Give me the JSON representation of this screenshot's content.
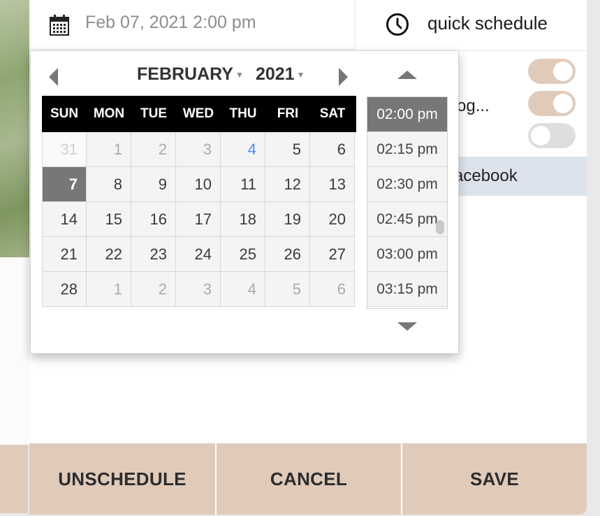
{
  "post": {
    "date_value": "Feb 07, 2021 2:00 pm",
    "quick_label": "quick schedule",
    "bg_snippet": "og...",
    "facebook_label": "acebook",
    "toggles": [
      true,
      true,
      false
    ]
  },
  "picker": {
    "month": "FEBRUARY",
    "year": "2021",
    "weekdays": [
      "SUN",
      "MON",
      "TUE",
      "WED",
      "THU",
      "FRI",
      "SAT"
    ],
    "weeks": [
      [
        "31",
        "1",
        "2",
        "3",
        "4",
        "5",
        "6"
      ],
      [
        "7",
        "8",
        "9",
        "10",
        "11",
        "12",
        "13"
      ],
      [
        "14",
        "15",
        "16",
        "17",
        "18",
        "19",
        "20"
      ],
      [
        "21",
        "22",
        "23",
        "24",
        "25",
        "26",
        "27"
      ],
      [
        "28",
        "1",
        "2",
        "3",
        "4",
        "5",
        "6"
      ]
    ],
    "times": [
      "02:00 pm",
      "02:15 pm",
      "02:30 pm",
      "02:45 pm",
      "03:00 pm",
      "03:15 pm"
    ],
    "selected_day": "7",
    "selected_time": "02:00 pm"
  },
  "actions": {
    "unschedule": "UNSCHEDULE",
    "cancel": "CANCEL",
    "save": "SAVE"
  },
  "colors": {
    "accent": "#e0cbbb",
    "selected": "#777777",
    "today": "#4a8cf0"
  }
}
